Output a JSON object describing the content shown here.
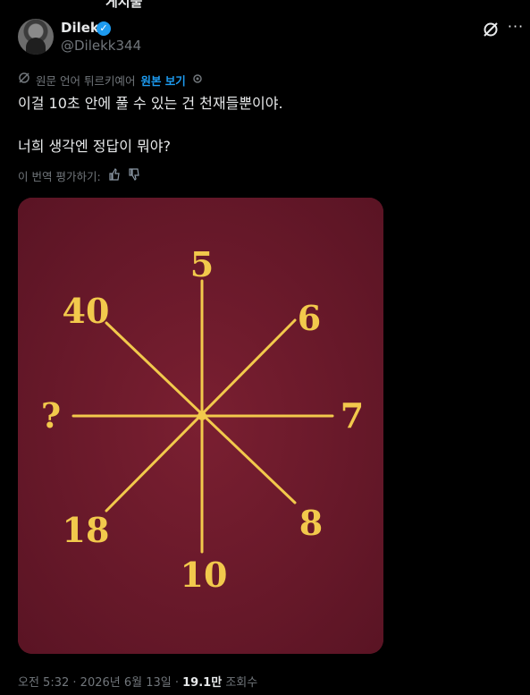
{
  "header_cut_text": "게시물",
  "author": {
    "display_name": "Dilek",
    "handle": "@Dilekk344",
    "verified_mark": "✓"
  },
  "actions": {
    "grok_icon": "grok-icon",
    "more_icon": "more-icon"
  },
  "translation": {
    "note": "원문 언어 튀르키예어",
    "show_original": "원본 보기"
  },
  "tweet": {
    "line1": "이걸 10초 안에 풀 수 있는 건 천재들뿐이야.",
    "line2": "너희 생각엔 정답이 뭐야?"
  },
  "rate": {
    "label": "이 번역 평가하기:"
  },
  "puzzle": {
    "background_color": "#6d1a2b",
    "line_color": "#f2c94c",
    "number_top": "5",
    "number_top_right": "6",
    "number_right": "7",
    "number_bottom_right": "8",
    "number_bottom": "10",
    "number_bottom_left": "18",
    "number_left": "?",
    "number_top_left": "40"
  },
  "meta": {
    "time": "오전 5:32",
    "date": "2026년 6월 13일",
    "views": "19.1만",
    "views_label": "조회수",
    "sep": "·"
  }
}
